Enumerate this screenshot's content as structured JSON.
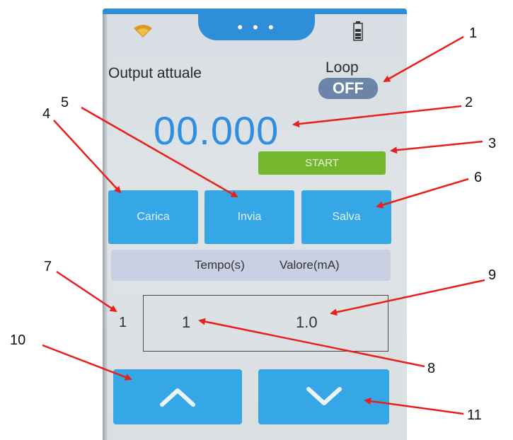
{
  "screen": {
    "accent_color": "#2e8ed8",
    "status_icons": [
      "wifi-icon",
      "battery-icon"
    ],
    "menu_dots": "• • •",
    "output_label": "Output attuale",
    "loop": {
      "label": "Loop",
      "state": "OFF"
    },
    "output_value": "00.000",
    "start_label": "START",
    "buttons": {
      "carica": "Carica",
      "invia": "Invia",
      "salva": "Salva"
    },
    "table": {
      "headers": [
        "Tempo(s)",
        "Valore(mA)"
      ],
      "row": {
        "index": "1",
        "tempo": "1",
        "valore": "1.0"
      }
    },
    "nav_icons": [
      "chevron-up-icon",
      "chevron-down-icon"
    ]
  },
  "callouts": [
    "1",
    "2",
    "3",
    "4",
    "5",
    "6",
    "7",
    "8",
    "9",
    "10",
    "11"
  ],
  "arrow_color": "#e8201c"
}
